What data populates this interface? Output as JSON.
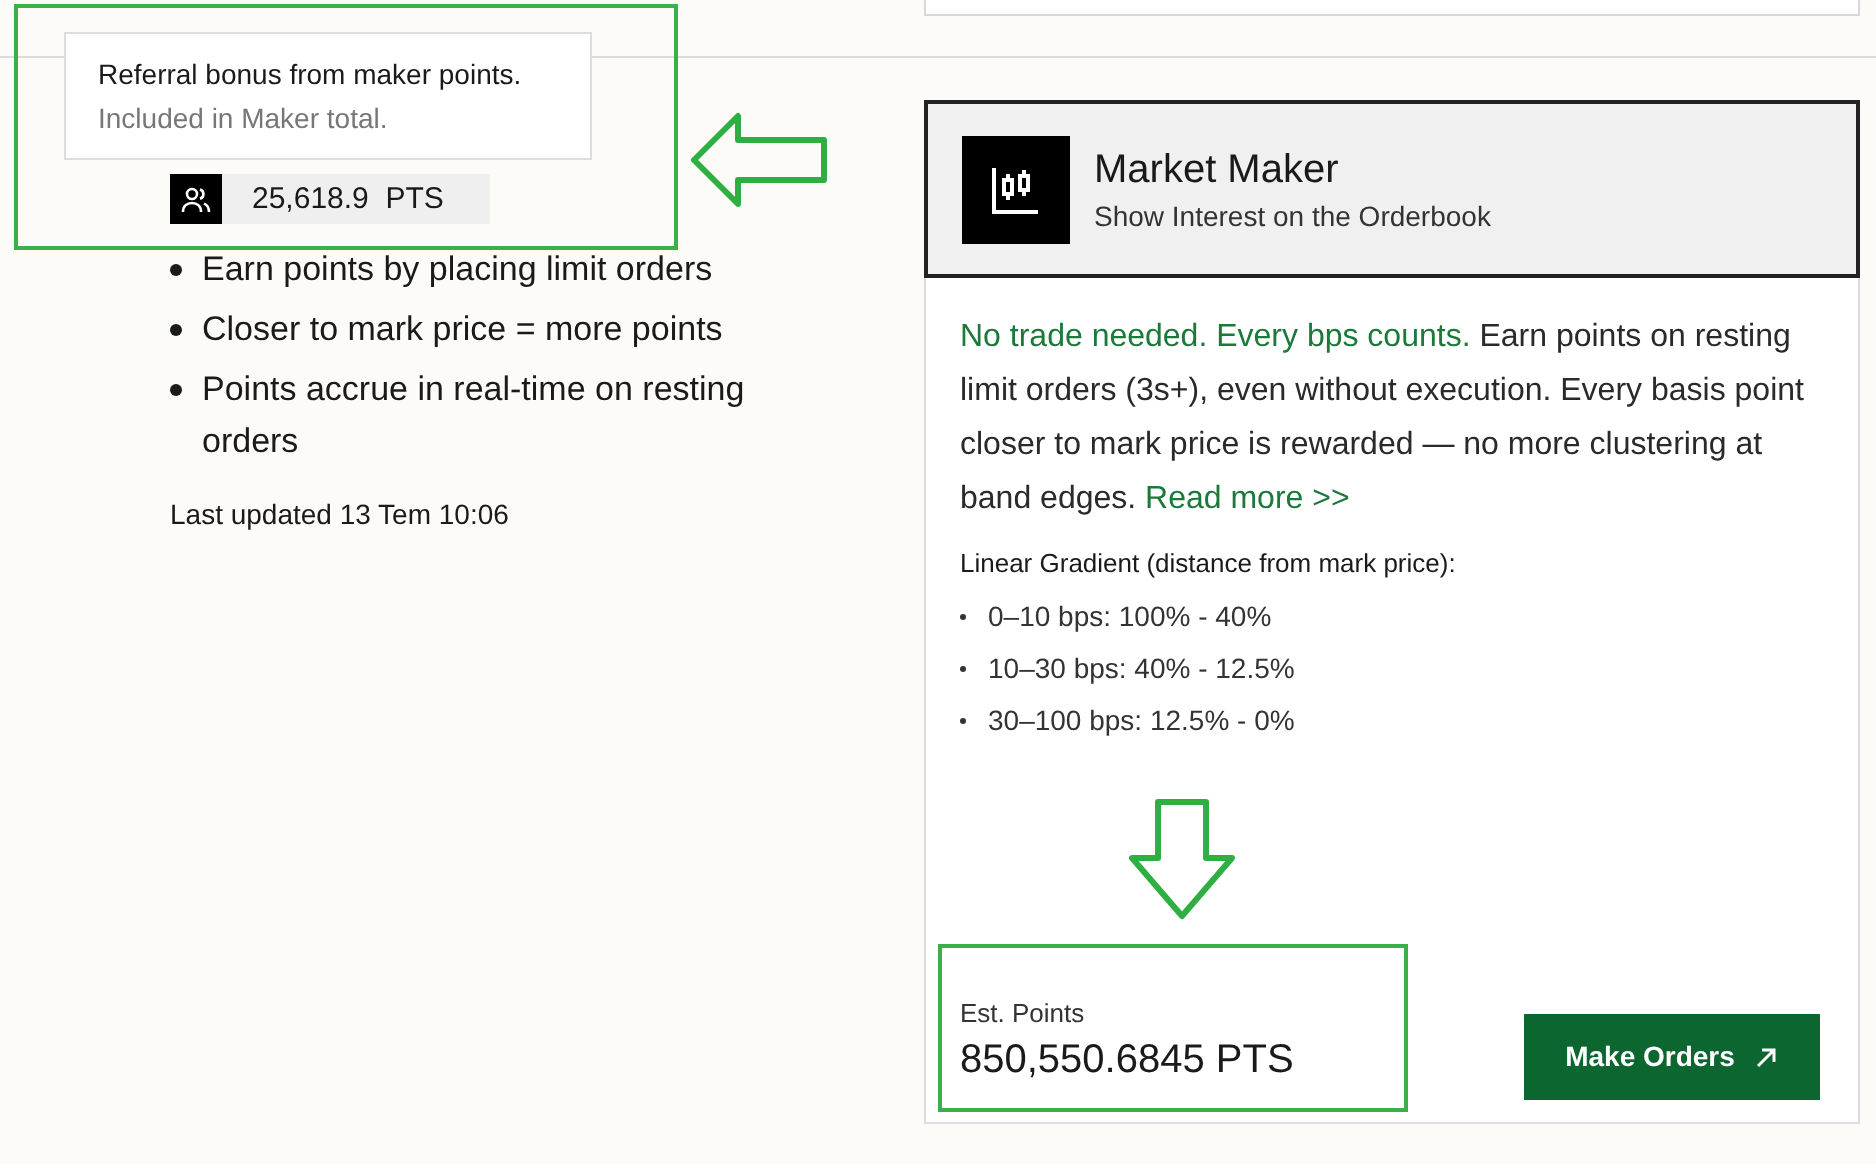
{
  "tooltip": {
    "title": "Referral bonus from maker points.",
    "note": "Included in Maker total."
  },
  "referral_points": "25,618.9  PTS",
  "features": [
    "Earn points by placing limit orders",
    "Closer to mark price = more points",
    "Points accrue in real-time on resting orders"
  ],
  "last_updated": "Last updated 13 Tem 10:06",
  "card": {
    "title": "Market Maker",
    "subtitle": "Show Interest on the Orderbook",
    "intro": {
      "lead": "No trade needed. Every bps counts.",
      "text": " Earn points on resting limit orders (3s+), even without execution. Every basis point closer to mark price is rewarded — no more clustering at band edges. ",
      "link": "Read more >>"
    },
    "gradient_label": "Linear Gradient (distance from mark price):",
    "gradient_tiers": [
      "0–10 bps: 100% - 40%",
      "10–30 bps: 40% - 12.5%",
      "30–100 bps: 12.5% - 0%"
    ],
    "est_label": "Est. Points",
    "est_value": "850,550.6845 PTS",
    "button": "Make Orders"
  }
}
